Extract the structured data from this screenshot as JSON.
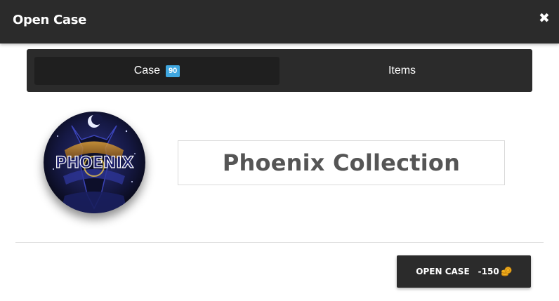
{
  "modal": {
    "title": "Open Case",
    "close_icon": "close-icon"
  },
  "tabs": [
    {
      "label": "Case",
      "badge": "90",
      "active": true
    },
    {
      "label": "Items",
      "active": false
    }
  ],
  "case": {
    "image_text": "PHOENIX",
    "name": "Phoenix Collection"
  },
  "open_button": {
    "label": "OPEN CASE",
    "price": "-150",
    "currency_icon": "coins-icon"
  },
  "colors": {
    "header_bg": "#2b2b2b",
    "active_tab_bg": "#1f1f1f",
    "badge": "#3fa7e0",
    "coin": "#f2b01e",
    "case_text": "#555555"
  }
}
